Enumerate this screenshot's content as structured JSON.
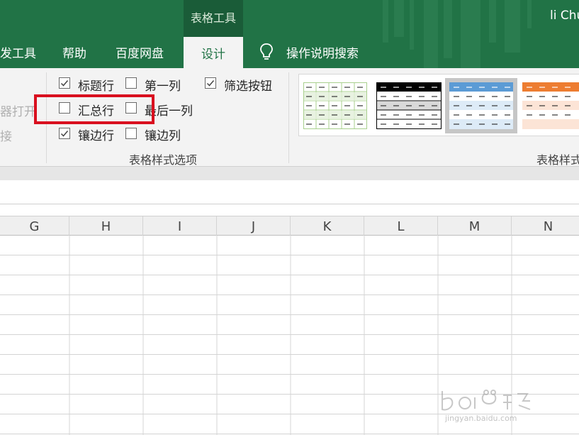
{
  "titlebar": {
    "context_group_label": "表格工具",
    "user_name": "li Chu"
  },
  "tabs": [
    {
      "label": "发工具",
      "active": false
    },
    {
      "label": "帮助",
      "active": false
    },
    {
      "label": "百度网盘",
      "active": false
    },
    {
      "label": "设计",
      "active": true
    }
  ],
  "tell_me": {
    "label": "操作说明搜索",
    "icon": "lightbulb-icon"
  },
  "ribbon": {
    "left_group_items": [
      "器打开",
      "接"
    ],
    "table_style_options": {
      "group_label": "表格样式选项",
      "options": [
        {
          "label": "标题行",
          "checked": true
        },
        {
          "label": "第一列",
          "checked": false
        },
        {
          "label": "筛选按钮",
          "checked": true
        },
        {
          "label": "汇总行",
          "checked": false
        },
        {
          "label": "最后一列",
          "checked": false
        },
        {
          "label": "镶边行",
          "checked": true
        },
        {
          "label": "镶边列",
          "checked": false
        }
      ]
    },
    "table_styles": {
      "group_label": "表格样式",
      "thumbnails": [
        {
          "name": "green-light",
          "accent": "#a9d08e",
          "fill": "#e2efda",
          "selected": false
        },
        {
          "name": "black-medium",
          "accent": "#000000",
          "fill": "#d9d9d9",
          "selected": false
        },
        {
          "name": "blue-medium",
          "accent": "#5b9bd5",
          "fill": "#ddebf7",
          "selected": true
        },
        {
          "name": "orange-medium",
          "accent": "#ed7d31",
          "fill": "#fce4d6",
          "selected": false
        }
      ]
    }
  },
  "sheet": {
    "columns": [
      "G",
      "H",
      "I",
      "J",
      "K",
      "L",
      "M",
      "N"
    ]
  },
  "colors": {
    "brand_green": "#217346",
    "highlight_red": "#d9101f"
  }
}
